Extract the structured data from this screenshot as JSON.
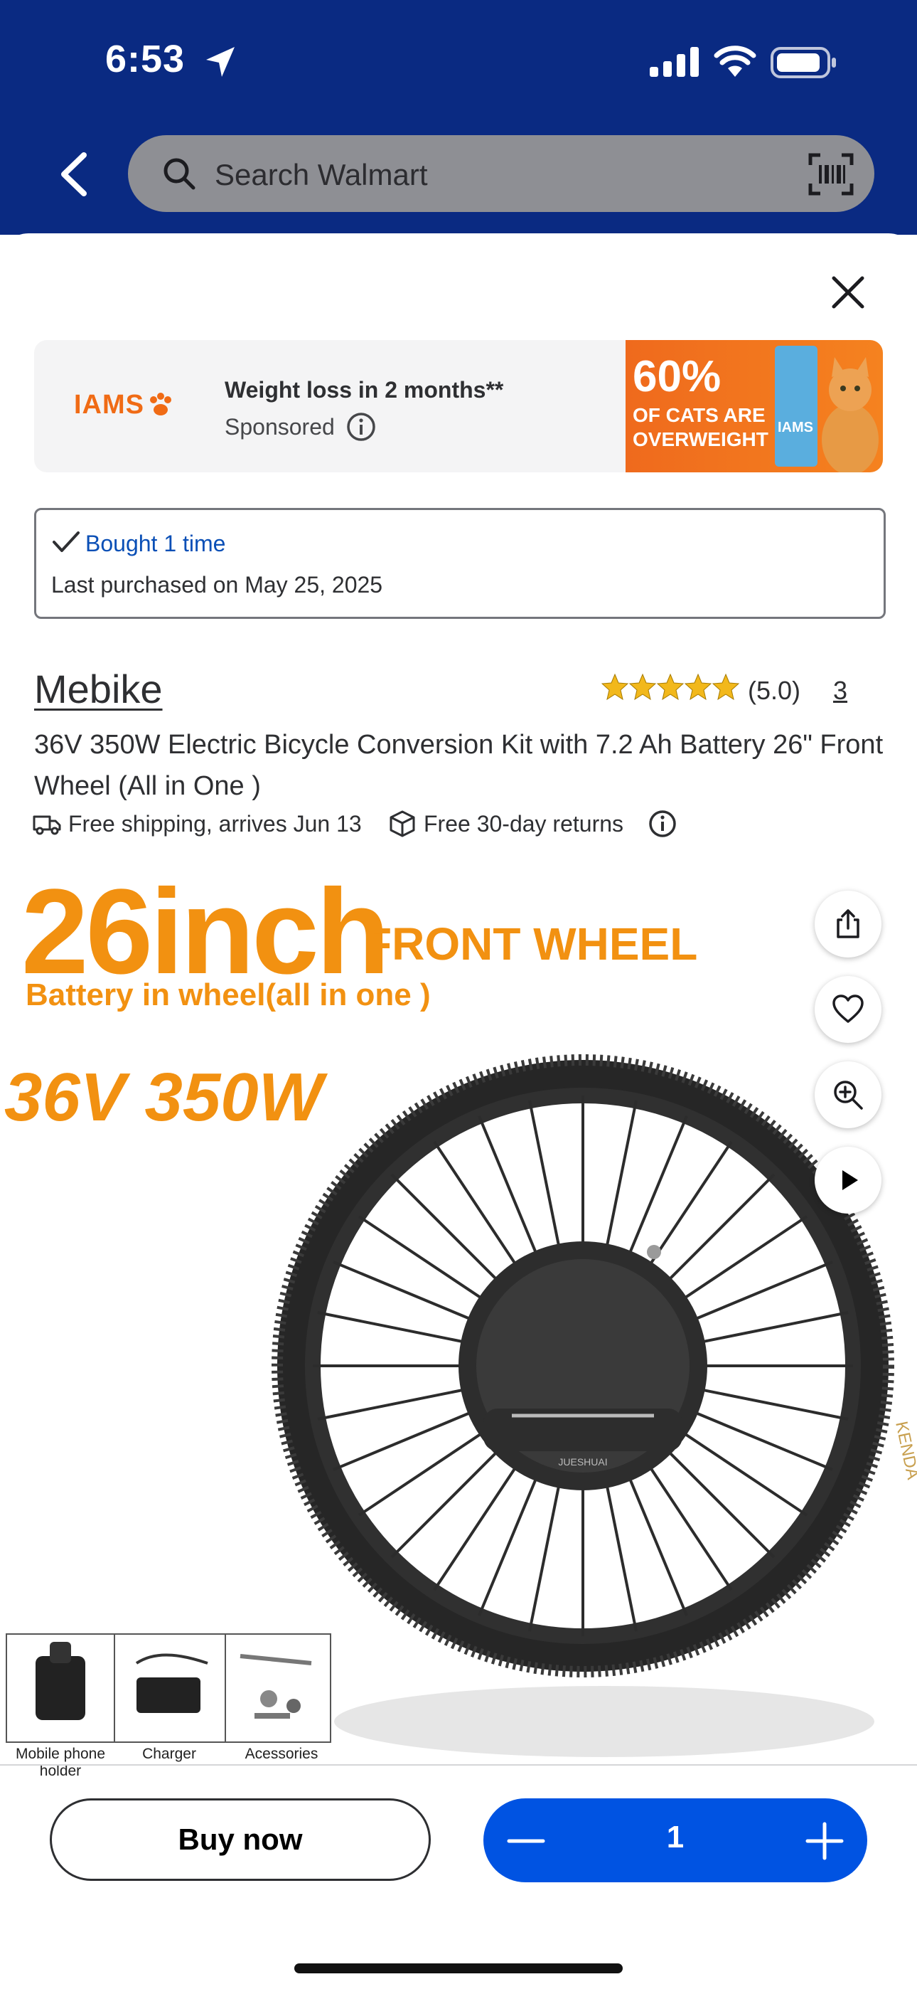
{
  "status_bar": {
    "time": "6:53"
  },
  "search": {
    "placeholder": "Search Walmart"
  },
  "ad": {
    "brand_logo": "IAMS",
    "title": "Weight loss in 2 months**",
    "sponsored": "Sponsored",
    "banner_big": "60%",
    "banner_line1": "OF CATS ARE",
    "banner_line2": "OVERWEIGHT",
    "banner_brand": "IAMS"
  },
  "purchase_history": {
    "bought": "Bought 1 time",
    "last_purchased": "Last purchased on May 25, 2025"
  },
  "product": {
    "brand": "Mebike",
    "rating": "(5.0)",
    "rating_stars": 5,
    "review_count": "3",
    "title": "36V 350W Electric Bicycle Conversion Kit with 7.2 Ah Battery 26\" Front Wheel (All in One )",
    "shipping": "Free shipping, arrives Jun 13",
    "returns": "Free 30-day returns"
  },
  "image": {
    "headline_size": "26inch",
    "headline_front": "FRONT WHEEL",
    "headline_battery": "Battery in wheel(all in one )",
    "headline_power": "36V 350W",
    "hub_brand": "JUESHUAI",
    "tire_brand": "KENDA",
    "accessories": [
      "Mobile phone holder",
      "Charger",
      "Acessories"
    ]
  },
  "actions": {
    "buy_now": "Buy now",
    "quantity": "1"
  },
  "colors": {
    "header_bg": "#0a2a82",
    "accent_blue": "#0053e2",
    "promo_orange": "#f29111"
  }
}
